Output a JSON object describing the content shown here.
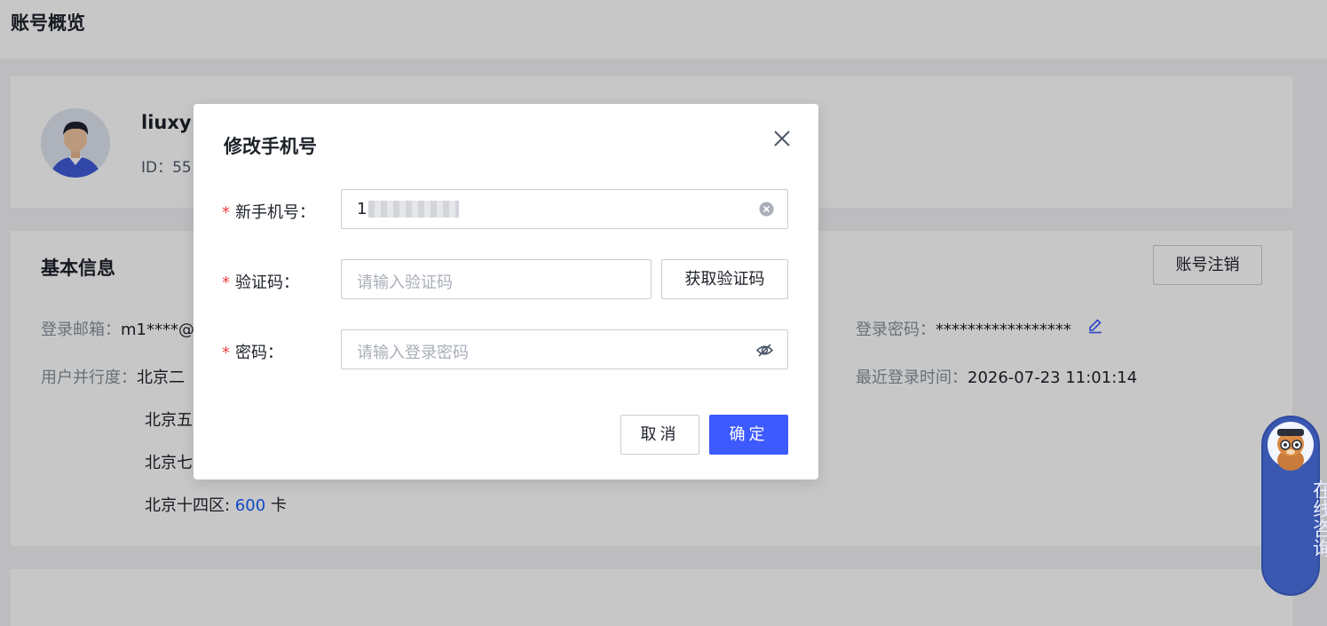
{
  "page": {
    "title": "账号概览"
  },
  "user": {
    "name": "liuxy",
    "id_label": "ID：55"
  },
  "basic_info": {
    "title": "基本信息",
    "cancel_account_label": "账号注销",
    "email_label": "登录邮箱：",
    "email_value": "m1****@",
    "password_label": "登录密码：",
    "password_value": "*****************",
    "concurrency_label": "用户并行度：",
    "concurrency_rows": [
      "北京二",
      "北京五",
      "北京七"
    ],
    "last_row_region": "北京十四区: ",
    "last_row_value": "600",
    "last_row_unit": " 卡",
    "last_login_label": "最近登录时间：",
    "last_login_value": "2026-07-23 11:01:14"
  },
  "modal": {
    "title": "修改手机号",
    "required_mark": "*",
    "phone_label": "新手机号：",
    "phone_value": "1",
    "code_label": "验证码：",
    "code_placeholder": "请输入验证码",
    "get_code_label": "获取验证码",
    "password_label": "密码：",
    "password_placeholder": "请输入登录密码",
    "cancel_label": "取消",
    "confirm_label": "确定"
  },
  "consult": {
    "label": "在线咨询"
  },
  "colors": {
    "primary": "#3d5afe",
    "required": "#f53f3f",
    "link": "#165dff",
    "widget": "#3b58b0"
  },
  "icons": [
    "close-icon",
    "clear-icon",
    "eye-off-icon",
    "edit-icon",
    "avatar-icon",
    "mascot-icon"
  ]
}
